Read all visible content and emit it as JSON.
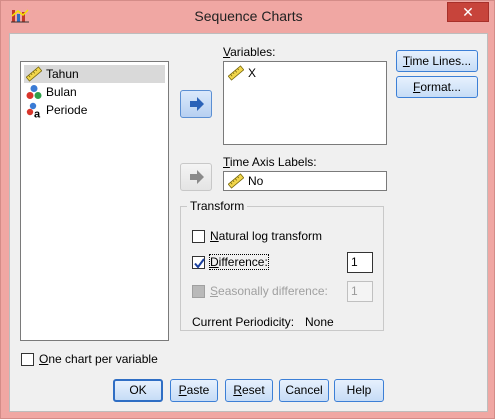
{
  "window": {
    "title": "Sequence Charts",
    "close_glyph": "✕"
  },
  "source_list": {
    "items": [
      {
        "label": "Tahun",
        "icon": "ruler-scale-icon",
        "selected": true
      },
      {
        "label": "Bulan",
        "icon": "ordinal-balls-icon",
        "selected": false
      },
      {
        "label": "Periode",
        "icon": "nominal-string-icon",
        "selected": false
      }
    ]
  },
  "variables": {
    "label_first": "V",
    "label_rest": "ariables:",
    "items": [
      {
        "label": "X",
        "icon": "ruler-scale-icon"
      }
    ]
  },
  "time_axis": {
    "label_first": "T",
    "label_rest": "ime Axis Labels:",
    "value": "No"
  },
  "side_buttons": {
    "time_lines": {
      "first": "T",
      "rest": "ime Lines..."
    },
    "format": {
      "first": "F",
      "rest": "ormat..."
    }
  },
  "transform": {
    "title": "Transform",
    "natural_log": {
      "first": "N",
      "rest": "atural log transform",
      "checked": false
    },
    "difference": {
      "first": "D",
      "rest": "ifference:",
      "checked": true,
      "value": "1"
    },
    "seasonal": {
      "first": "S",
      "rest": "easonally difference:",
      "checked": false,
      "enabled": false,
      "value": "1"
    },
    "periodicity_label": "Current Periodicity:",
    "periodicity_value": "None"
  },
  "one_chart": {
    "first": "O",
    "rest": "ne chart per variable",
    "checked": false
  },
  "buttons": {
    "ok": "OK",
    "paste": {
      "first": "P",
      "rest": "aste"
    },
    "reset": {
      "first": "R",
      "rest": "eset"
    },
    "cancel": "Cancel",
    "help": "Help"
  }
}
